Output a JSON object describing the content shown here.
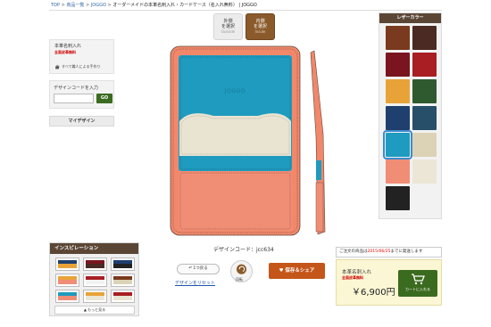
{
  "breadcrumb": {
    "items": [
      "TOP",
      "商品一覧",
      "JOGGO"
    ],
    "separator": ">",
    "current": "オーダーメイドの本革名刺入れ・カードケース（名入れ無料） | JOGGO"
  },
  "product": {
    "name": "本革名刺入れ",
    "note": "全面皮革無料",
    "handwork": "すべて職人による手作り"
  },
  "design_code_input": {
    "label": "デザインコードを入力",
    "value": "",
    "go_label": "GO"
  },
  "my_design_label": "マイデザイン",
  "side_toggle": {
    "outside": {
      "label_line1": "外側",
      "label_line2": "を選択",
      "sub": "Outside"
    },
    "inside": {
      "label_line1": "内側",
      "label_line2": "を選択",
      "sub": "Inside"
    },
    "selected": "inside"
  },
  "case": {
    "brand": "JOGGO",
    "colors": {
      "frame": "#f2876a",
      "upper_pocket": "#1e9bbf",
      "inner_panel": "#e9e3d2",
      "lower_pocket": "#f08d75",
      "stitch": "#5e4a3e"
    }
  },
  "design_code_display": "デザインコード：jcc634",
  "leather": {
    "title": "レザーカラー",
    "colors": [
      "#7a3a1f",
      "#4a2a22",
      "#7a1520",
      "#a81e22",
      "#e8a338",
      "#2f5a2f",
      "#1f3f6e",
      "#274f6a",
      "#1e9bbf",
      "#dcd2b6",
      "#f08d75",
      "#ebe6d6",
      "#222222"
    ],
    "selected_index": 8
  },
  "inspiration": {
    "title": "インスピレーション",
    "more_label": "もっと見る",
    "thumbs": [
      {
        "top": "#1f3f6e",
        "bottom": "#e8a338"
      },
      {
        "top": "#7a1520",
        "bottom": "#4a2a22"
      },
      {
        "top": "#1f3f6e",
        "bottom": "#222222"
      },
      {
        "top": "#e8a338",
        "bottom": "#f08d75"
      },
      {
        "top": "#a81e22",
        "bottom": "#f2f2f2"
      },
      {
        "top": "#7a3a1f",
        "bottom": "#dcd2b6"
      },
      {
        "top": "#1e9bbf",
        "bottom": "#f08d75"
      },
      {
        "top": "#e8a338",
        "bottom": "#ebe6d6"
      },
      {
        "top": "#a81e22",
        "bottom": "#e9e3d2"
      }
    ]
  },
  "actions": {
    "back_label": "1つ戻る",
    "reset_label": "デザインをリセット",
    "rotate_label": "回転",
    "save_label": "保存＆シェア"
  },
  "order": {
    "ship_prefix": "ご注文の商品は",
    "ship_date": "2015/06/25",
    "ship_suffix": "までに発送します",
    "product_name": "本革名刺入れ",
    "product_note": "全面皮革無料",
    "price": "￥6,900円",
    "cart_label": "カートに入れる"
  }
}
